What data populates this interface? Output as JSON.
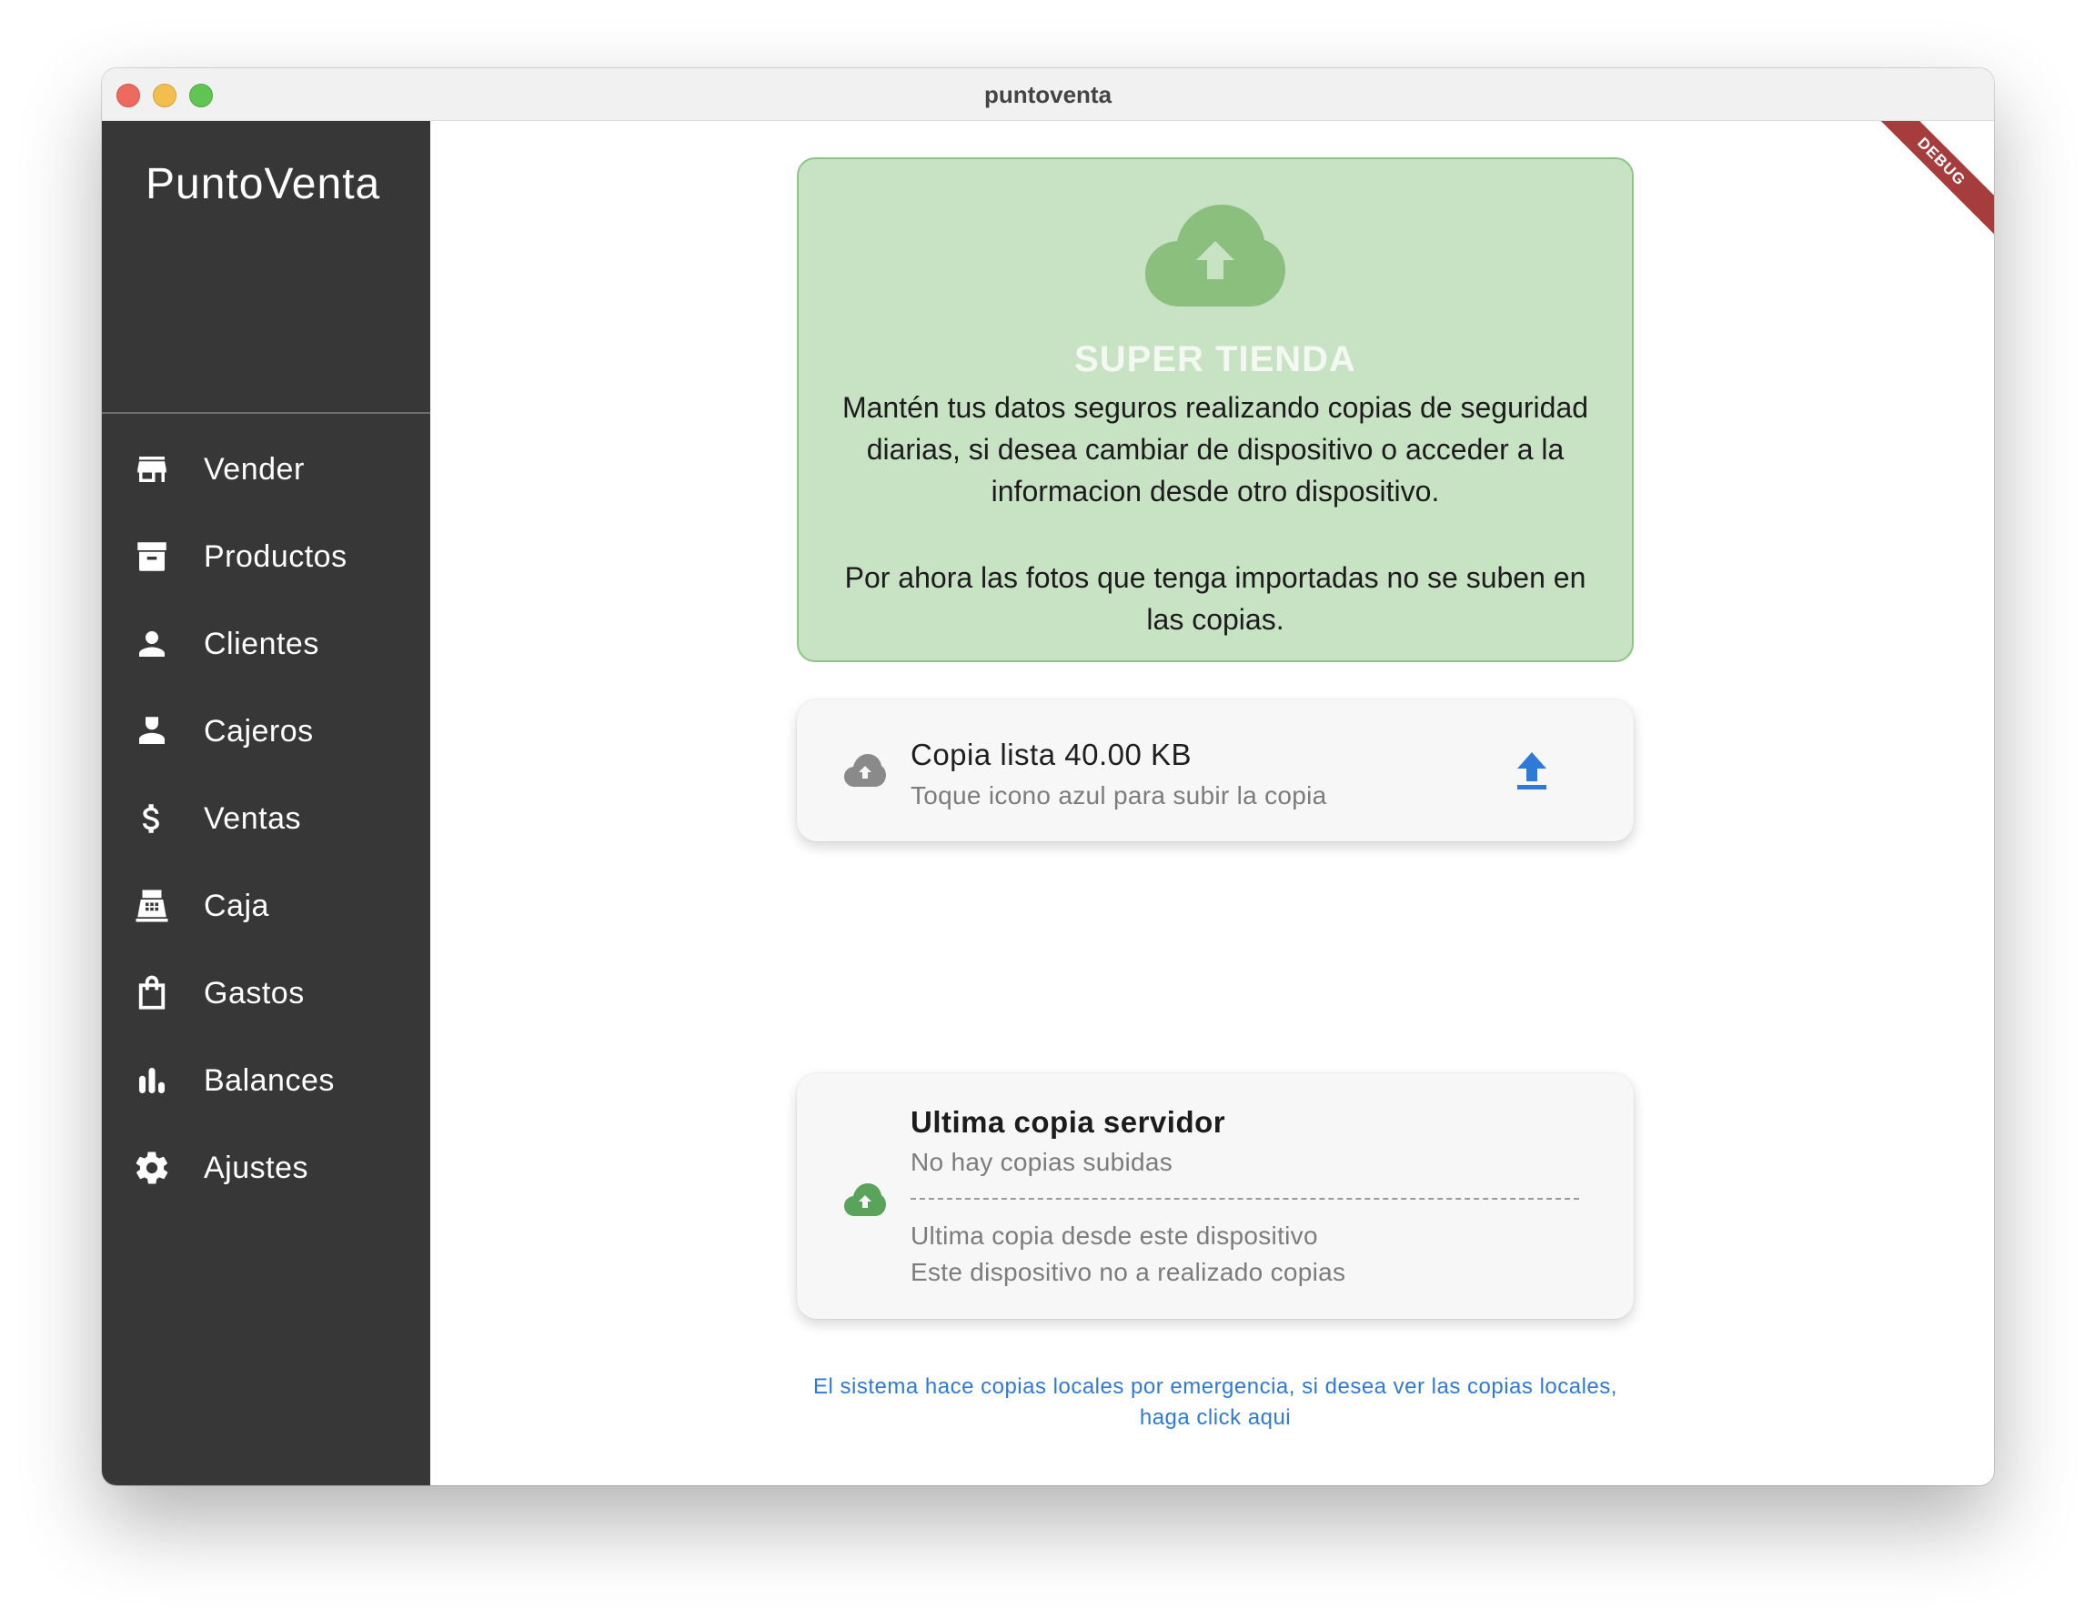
{
  "window": {
    "title": "puntoventa"
  },
  "sidebar": {
    "brand": "PuntoVenta",
    "items": [
      {
        "label": "Vender",
        "icon": "store-icon"
      },
      {
        "label": "Productos",
        "icon": "archive-icon"
      },
      {
        "label": "Clientes",
        "icon": "person-icon"
      },
      {
        "label": "Cajeros",
        "icon": "cashier-icon"
      },
      {
        "label": "Ventas",
        "icon": "dollar-icon"
      },
      {
        "label": "Caja",
        "icon": "cash-register-icon"
      },
      {
        "label": "Gastos",
        "icon": "shopping-bag-icon"
      },
      {
        "label": "Balances",
        "icon": "bar-chart-icon"
      },
      {
        "label": "Ajustes",
        "icon": "gear-icon"
      }
    ]
  },
  "debug_banner": "DEBUG",
  "hero": {
    "title": "SUPER TIENDA",
    "description": "Mantén tus datos seguros realizando copias de seguridad diarias, si desea cambiar de dispositivo o acceder a la informacion desde otro dispositivo.",
    "note": "Por ahora las fotos que tenga importadas no se suben en las copias."
  },
  "backup_card": {
    "title": "Copia lista 40.00 KB",
    "subtitle": "Toque icono azul para subir la copia"
  },
  "server_card": {
    "title": "Ultima copia servidor",
    "subtitle": "No hay copias subidas",
    "local_title": "Ultima copia desde este dispositivo",
    "local_status": "Este dispositivo no a realizado copias"
  },
  "local_copies_link": "El sistema hace copias locales por emergencia, si desea ver las copias locales, haga click aqui",
  "colors": {
    "sidebar_bg": "#373737",
    "hero_bg": "#c8e2c4",
    "hero_icon": "#8abf7e",
    "accent_blue": "#2f7ad6",
    "server_cloud": "#5aa35a"
  }
}
